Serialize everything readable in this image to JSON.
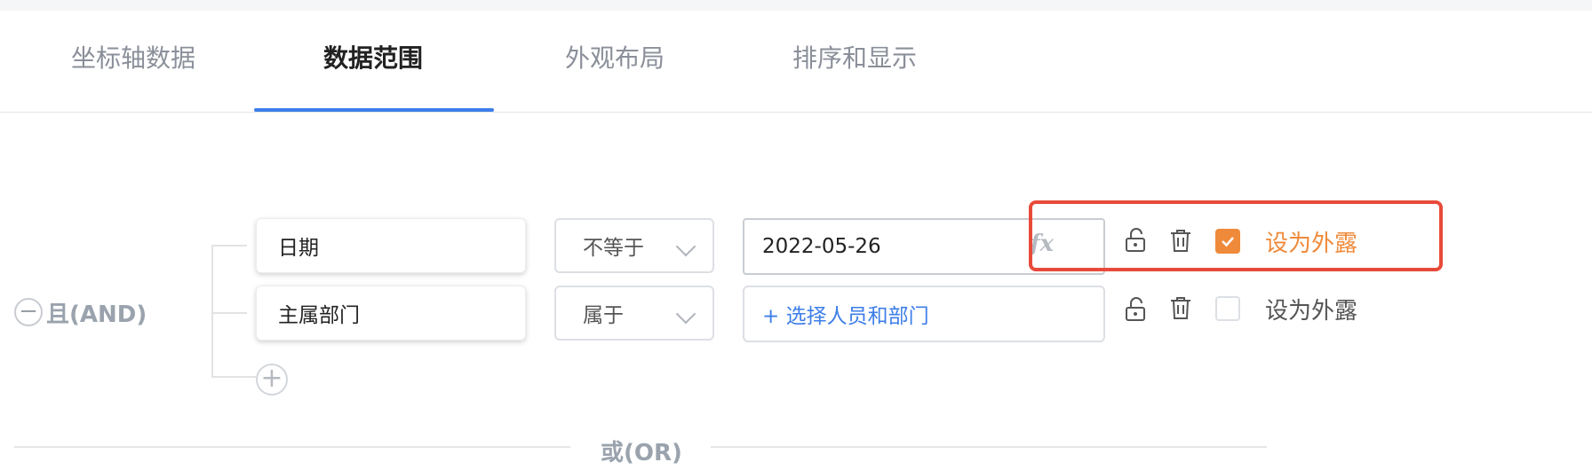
{
  "tabs": [
    {
      "label": "坐标轴数据",
      "active": false
    },
    {
      "label": "数据范围",
      "active": true
    },
    {
      "label": "外观布局",
      "active": false
    },
    {
      "label": "排序和显示",
      "active": false
    }
  ],
  "filter_group": {
    "logic_label": "且(AND)",
    "conditions": [
      {
        "field": "日期",
        "operator": "不等于",
        "value": "2022-05-26",
        "fx_label": "fx",
        "expose_checked": true,
        "expose_label": "设为外露"
      },
      {
        "field": "主属部门",
        "operator": "属于",
        "value_link": "+ 选择人员和部门",
        "expose_checked": false,
        "expose_label": "设为外露"
      }
    ]
  },
  "or_divider_label": "或(OR)",
  "colors": {
    "accent_blue": "#3d7ee8",
    "checked_orange": "#ef8a3a",
    "highlight_red": "#e84a3a"
  },
  "icons": [
    "minus-circle-icon",
    "plus-circle-icon",
    "unlock-icon",
    "trash-icon",
    "chevron-down-icon",
    "check-icon"
  ]
}
